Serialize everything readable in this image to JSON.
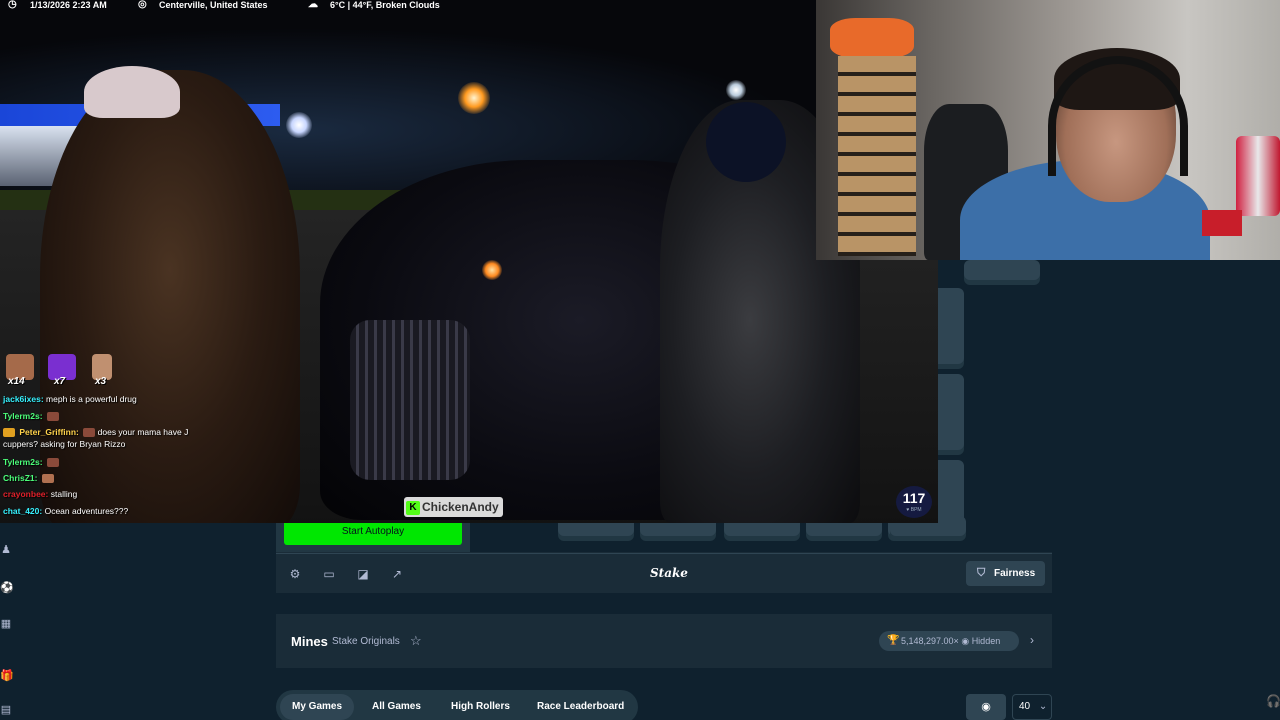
{
  "stream": {
    "info": {
      "datetime": "1/13/2026 2:23 AM",
      "location": "Centerville, United States",
      "weather": "6°C | 44°F, Broken Clouds"
    },
    "emote_counts": [
      "x14",
      "x7",
      "x3"
    ],
    "chat": [
      {
        "user": "jack6ixes:",
        "color": "#36f2ff",
        "message": "meph is a powerful drug"
      },
      {
        "user": "Tylerm2s:",
        "color": "#4cff7a",
        "message": ""
      },
      {
        "user": "Peter_Griffinn:",
        "color": "#ffd34c",
        "message": "does your mama have J"
      },
      {
        "user": "",
        "color": "#ffffff",
        "message": "cuppers? asking for Bryan Rizzo"
      },
      {
        "user": "Tylerm2s:",
        "color": "#4cff7a",
        "message": ""
      },
      {
        "user": "ChrisZ1:",
        "color": "#4cff7a",
        "message": ""
      },
      {
        "user": "crayonbee:",
        "color": "#e0202a",
        "message": "stalling"
      },
      {
        "user": "chat_420:",
        "color": "#36f2ff",
        "message": "Ocean adventures???"
      }
    ],
    "watermark": "ChickenAndy",
    "watermark_badge": "K",
    "bpm_value": "117",
    "bpm_unit": "♥ BPM"
  },
  "game": {
    "autoplay_label": "Start Autoplay",
    "logo": "Stake",
    "fairness_label": "Fairness",
    "title": "Mines",
    "subtitle": "Stake Originals",
    "multiplier": "5,148,297.00×",
    "hidden_label": "Hidden",
    "accent": "#00e701"
  },
  "tabs": [
    "My Games",
    "All Games",
    "High Rollers",
    "Race Leaderboard"
  ],
  "count_select": "40",
  "icons": {
    "settings": "gear-icon",
    "theatre": "theatre-mode-icon",
    "stats": "stats-icon",
    "popout": "popout-icon",
    "star": "star-icon",
    "trophy": "trophy-icon",
    "ghost": "hidden-icon",
    "headset": "headset-icon"
  }
}
